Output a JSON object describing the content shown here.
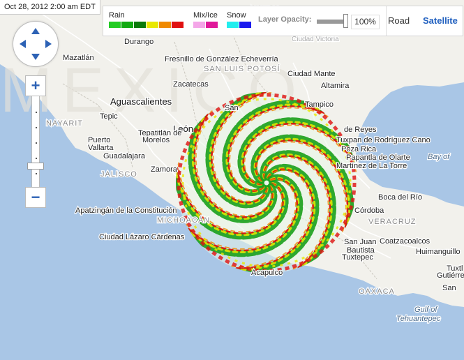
{
  "timestamp": "Oct 28, 2012 2:00 am EDT",
  "legend": {
    "rain": {
      "label": "Rain",
      "colors": [
        "#22cc22",
        "#11aa11",
        "#0a7a0a",
        "#e8e800",
        "#f08a00",
        "#e01010"
      ]
    },
    "mix": {
      "label": "Mix/Ice",
      "colors": [
        "#f4a6e8",
        "#e0199a"
      ]
    },
    "snow": {
      "label": "Snow",
      "colors": [
        "#22eeee",
        "#1a1aee"
      ]
    }
  },
  "opacity": {
    "label": "Layer Opacity:",
    "value": "100%"
  },
  "map_type": {
    "road": "Road",
    "satellite": "Satellite",
    "selected": "Satellite"
  },
  "zoom": {
    "in": "+",
    "out": "−"
  },
  "map": {
    "watermark": "MEXICO",
    "land_color": "#f2f1ec",
    "water_color": "#a9c6e6",
    "labels": [
      {
        "text": "Nuevo",
        "kind": "state"
      },
      {
        "text": "Ciudad Victoria",
        "kind": "city_light"
      },
      {
        "text": "Mazatlán",
        "kind": "city"
      },
      {
        "text": "Durango",
        "kind": "city"
      },
      {
        "text": "Fresnillo de González Echeverría",
        "kind": "city"
      },
      {
        "text": "San Luis Potosí",
        "kind": "state"
      },
      {
        "text": "Ciudad Mante",
        "kind": "city"
      },
      {
        "text": "Zacatecas",
        "kind": "city"
      },
      {
        "text": "Altamira",
        "kind": "city"
      },
      {
        "text": "Aguascalientes",
        "kind": "bigcity"
      },
      {
        "text": "Tampico",
        "kind": "city"
      },
      {
        "text": "San",
        "kind": "city"
      },
      {
        "text": "Nayarit",
        "kind": "state"
      },
      {
        "text": "Tepic",
        "kind": "city"
      },
      {
        "text": "León",
        "kind": "bigcity"
      },
      {
        "text": "de Reyes",
        "kind": "city"
      },
      {
        "text": "Tepatitlán de",
        "kind": "city"
      },
      {
        "text": "Morelos",
        "kind": "city"
      },
      {
        "text": "Puerto",
        "kind": "city"
      },
      {
        "text": "Vallarta",
        "kind": "city"
      },
      {
        "text": "Tuxpan de Rodríguez Cano",
        "kind": "city"
      },
      {
        "text": "Guadalajara",
        "kind": "city"
      },
      {
        "text": "Poza Rica",
        "kind": "city"
      },
      {
        "text": "Papantla de Olarte",
        "kind": "city"
      },
      {
        "text": "Zamora",
        "kind": "city"
      },
      {
        "text": "Bay of",
        "kind": "water"
      },
      {
        "text": "Jalisco",
        "kind": "state"
      },
      {
        "text": "Martínez de La Torre",
        "kind": "city"
      },
      {
        "text": "Boca del Río",
        "kind": "city"
      },
      {
        "text": "Apatzingán de la Constitución",
        "kind": "city"
      },
      {
        "text": "Michoacán",
        "kind": "state"
      },
      {
        "text": "Córdoba",
        "kind": "city"
      },
      {
        "text": "Veracruz",
        "kind": "state"
      },
      {
        "text": "Ciudad Lázaro Cárdenas",
        "kind": "city"
      },
      {
        "text": "San Juan",
        "kind": "city"
      },
      {
        "text": "Bautista",
        "kind": "city"
      },
      {
        "text": "Tuxtepec",
        "kind": "city"
      },
      {
        "text": "Coatzacoalcos",
        "kind": "city"
      },
      {
        "text": "Huimanguillo",
        "kind": "city"
      },
      {
        "text": "Tuxtl",
        "kind": "city"
      },
      {
        "text": "Gutiérre",
        "kind": "city"
      },
      {
        "text": "Acapulco",
        "kind": "city"
      },
      {
        "text": "Oaxaca",
        "kind": "state"
      },
      {
        "text": "San",
        "kind": "city"
      },
      {
        "text": "Gulf of",
        "kind": "water"
      },
      {
        "text": "Tehuantepec",
        "kind": "water"
      }
    ]
  }
}
